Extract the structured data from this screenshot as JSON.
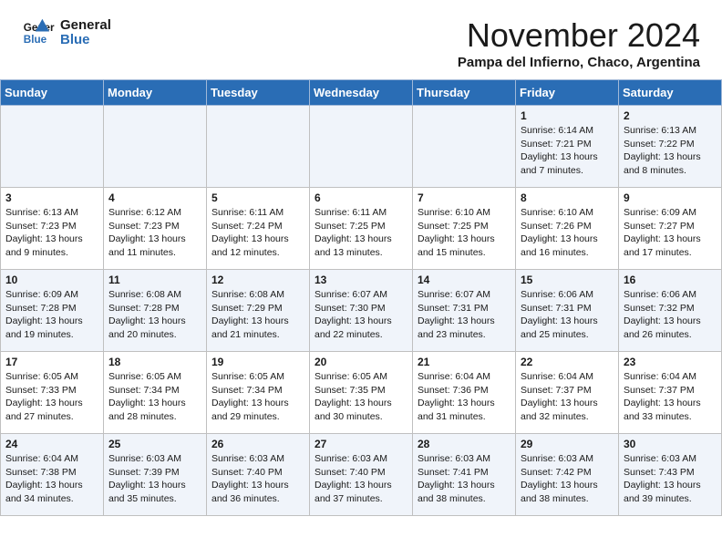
{
  "header": {
    "logo_line1": "General",
    "logo_line2": "Blue",
    "month_title": "November 2024",
    "location": "Pampa del Infierno, Chaco, Argentina"
  },
  "days_of_week": [
    "Sunday",
    "Monday",
    "Tuesday",
    "Wednesday",
    "Thursday",
    "Friday",
    "Saturday"
  ],
  "weeks": [
    [
      {
        "day": "",
        "info": ""
      },
      {
        "day": "",
        "info": ""
      },
      {
        "day": "",
        "info": ""
      },
      {
        "day": "",
        "info": ""
      },
      {
        "day": "",
        "info": ""
      },
      {
        "day": "1",
        "info": "Sunrise: 6:14 AM\nSunset: 7:21 PM\nDaylight: 13 hours\nand 7 minutes."
      },
      {
        "day": "2",
        "info": "Sunrise: 6:13 AM\nSunset: 7:22 PM\nDaylight: 13 hours\nand 8 minutes."
      }
    ],
    [
      {
        "day": "3",
        "info": "Sunrise: 6:13 AM\nSunset: 7:23 PM\nDaylight: 13 hours\nand 9 minutes."
      },
      {
        "day": "4",
        "info": "Sunrise: 6:12 AM\nSunset: 7:23 PM\nDaylight: 13 hours\nand 11 minutes."
      },
      {
        "day": "5",
        "info": "Sunrise: 6:11 AM\nSunset: 7:24 PM\nDaylight: 13 hours\nand 12 minutes."
      },
      {
        "day": "6",
        "info": "Sunrise: 6:11 AM\nSunset: 7:25 PM\nDaylight: 13 hours\nand 13 minutes."
      },
      {
        "day": "7",
        "info": "Sunrise: 6:10 AM\nSunset: 7:25 PM\nDaylight: 13 hours\nand 15 minutes."
      },
      {
        "day": "8",
        "info": "Sunrise: 6:10 AM\nSunset: 7:26 PM\nDaylight: 13 hours\nand 16 minutes."
      },
      {
        "day": "9",
        "info": "Sunrise: 6:09 AM\nSunset: 7:27 PM\nDaylight: 13 hours\nand 17 minutes."
      }
    ],
    [
      {
        "day": "10",
        "info": "Sunrise: 6:09 AM\nSunset: 7:28 PM\nDaylight: 13 hours\nand 19 minutes."
      },
      {
        "day": "11",
        "info": "Sunrise: 6:08 AM\nSunset: 7:28 PM\nDaylight: 13 hours\nand 20 minutes."
      },
      {
        "day": "12",
        "info": "Sunrise: 6:08 AM\nSunset: 7:29 PM\nDaylight: 13 hours\nand 21 minutes."
      },
      {
        "day": "13",
        "info": "Sunrise: 6:07 AM\nSunset: 7:30 PM\nDaylight: 13 hours\nand 22 minutes."
      },
      {
        "day": "14",
        "info": "Sunrise: 6:07 AM\nSunset: 7:31 PM\nDaylight: 13 hours\nand 23 minutes."
      },
      {
        "day": "15",
        "info": "Sunrise: 6:06 AM\nSunset: 7:31 PM\nDaylight: 13 hours\nand 25 minutes."
      },
      {
        "day": "16",
        "info": "Sunrise: 6:06 AM\nSunset: 7:32 PM\nDaylight: 13 hours\nand 26 minutes."
      }
    ],
    [
      {
        "day": "17",
        "info": "Sunrise: 6:05 AM\nSunset: 7:33 PM\nDaylight: 13 hours\nand 27 minutes."
      },
      {
        "day": "18",
        "info": "Sunrise: 6:05 AM\nSunset: 7:34 PM\nDaylight: 13 hours\nand 28 minutes."
      },
      {
        "day": "19",
        "info": "Sunrise: 6:05 AM\nSunset: 7:34 PM\nDaylight: 13 hours\nand 29 minutes."
      },
      {
        "day": "20",
        "info": "Sunrise: 6:05 AM\nSunset: 7:35 PM\nDaylight: 13 hours\nand 30 minutes."
      },
      {
        "day": "21",
        "info": "Sunrise: 6:04 AM\nSunset: 7:36 PM\nDaylight: 13 hours\nand 31 minutes."
      },
      {
        "day": "22",
        "info": "Sunrise: 6:04 AM\nSunset: 7:37 PM\nDaylight: 13 hours\nand 32 minutes."
      },
      {
        "day": "23",
        "info": "Sunrise: 6:04 AM\nSunset: 7:37 PM\nDaylight: 13 hours\nand 33 minutes."
      }
    ],
    [
      {
        "day": "24",
        "info": "Sunrise: 6:04 AM\nSunset: 7:38 PM\nDaylight: 13 hours\nand 34 minutes."
      },
      {
        "day": "25",
        "info": "Sunrise: 6:03 AM\nSunset: 7:39 PM\nDaylight: 13 hours\nand 35 minutes."
      },
      {
        "day": "26",
        "info": "Sunrise: 6:03 AM\nSunset: 7:40 PM\nDaylight: 13 hours\nand 36 minutes."
      },
      {
        "day": "27",
        "info": "Sunrise: 6:03 AM\nSunset: 7:40 PM\nDaylight: 13 hours\nand 37 minutes."
      },
      {
        "day": "28",
        "info": "Sunrise: 6:03 AM\nSunset: 7:41 PM\nDaylight: 13 hours\nand 38 minutes."
      },
      {
        "day": "29",
        "info": "Sunrise: 6:03 AM\nSunset: 7:42 PM\nDaylight: 13 hours\nand 38 minutes."
      },
      {
        "day": "30",
        "info": "Sunrise: 6:03 AM\nSunset: 7:43 PM\nDaylight: 13 hours\nand 39 minutes."
      }
    ]
  ]
}
